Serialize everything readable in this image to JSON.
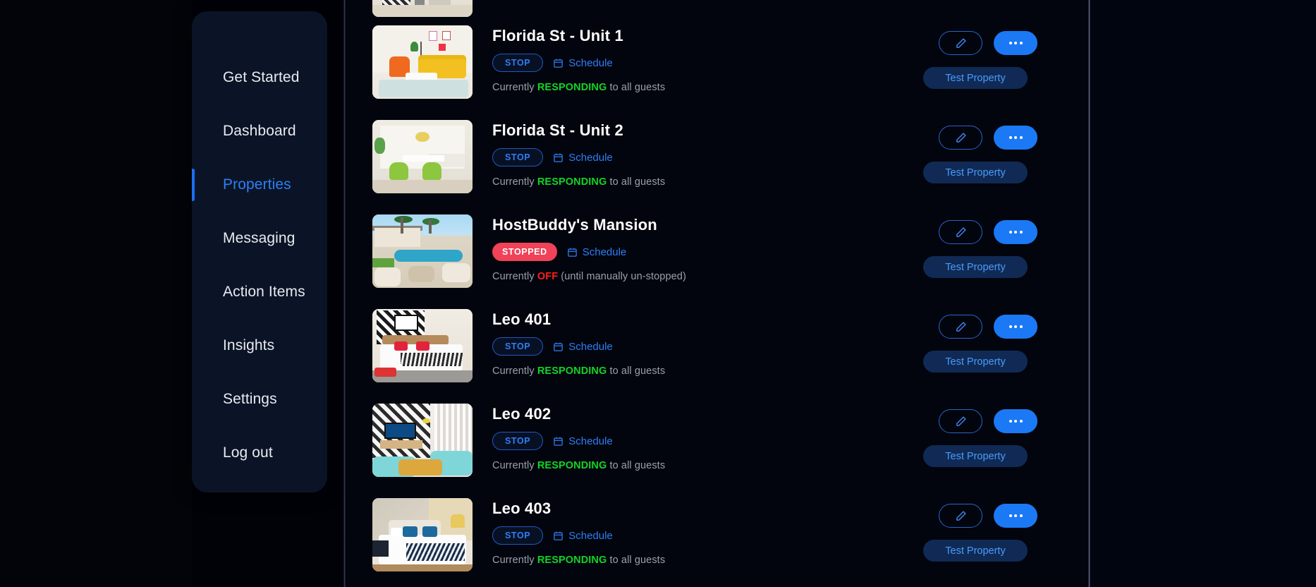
{
  "sidebar": {
    "items": [
      {
        "label": "Get Started",
        "active": false
      },
      {
        "label": "Dashboard",
        "active": false
      },
      {
        "label": "Properties",
        "active": true
      },
      {
        "label": "Messaging",
        "active": false
      },
      {
        "label": "Action Items",
        "active": false
      },
      {
        "label": "Insights",
        "active": false
      },
      {
        "label": "Settings",
        "active": false
      },
      {
        "label": "Log out",
        "active": false
      }
    ]
  },
  "colors": {
    "accent_blue": "#2f7ef6",
    "solid_blue": "#1b79f5",
    "responding_green": "#12d423",
    "off_red": "#ff1f1f",
    "stopped_badge": "#f04258",
    "panel_bg": "#0b1426",
    "page_bg": "#02050d"
  },
  "actions": {
    "edit_icon": "pencil-icon",
    "more_icon": "ellipsis-icon",
    "test_label": "Test Property",
    "schedule_label": "Schedule",
    "schedule_icon": "calendar-icon"
  },
  "status_text": {
    "prefix": "Currently ",
    "responding_word": "RESPONDING",
    "responding_suffix": " to all guests",
    "off_word": "OFF",
    "off_suffix": " (until manually un-stopped)"
  },
  "properties": [
    {
      "name": "",
      "badge": "",
      "badge_type": "none",
      "status_type": "none",
      "thumb": "partial-room",
      "partial": true
    },
    {
      "name": "Florida St - Unit 1",
      "badge": "STOP",
      "badge_type": "stop",
      "status_type": "responding",
      "thumb": "living-room-yellow-sofa",
      "partial": false
    },
    {
      "name": "Florida St - Unit 2",
      "badge": "STOP",
      "badge_type": "stop",
      "status_type": "responding",
      "thumb": "dining-room-green-chairs",
      "partial": false
    },
    {
      "name": "HostBuddy's Mansion",
      "badge": "STOPPED",
      "badge_type": "stopped",
      "status_type": "off",
      "thumb": "backyard-pool",
      "partial": false
    },
    {
      "name": "Leo 401",
      "badge": "STOP",
      "badge_type": "stop",
      "status_type": "responding",
      "thumb": "bedroom-red-pillows",
      "partial": false
    },
    {
      "name": "Leo 402",
      "badge": "STOP",
      "badge_type": "stop",
      "status_type": "responding",
      "thumb": "living-room-teal-gold",
      "partial": false
    },
    {
      "name": "Leo 403",
      "badge": "STOP",
      "badge_type": "stop",
      "status_type": "responding",
      "thumb": "bedroom-blue-pillows",
      "partial": false
    }
  ]
}
